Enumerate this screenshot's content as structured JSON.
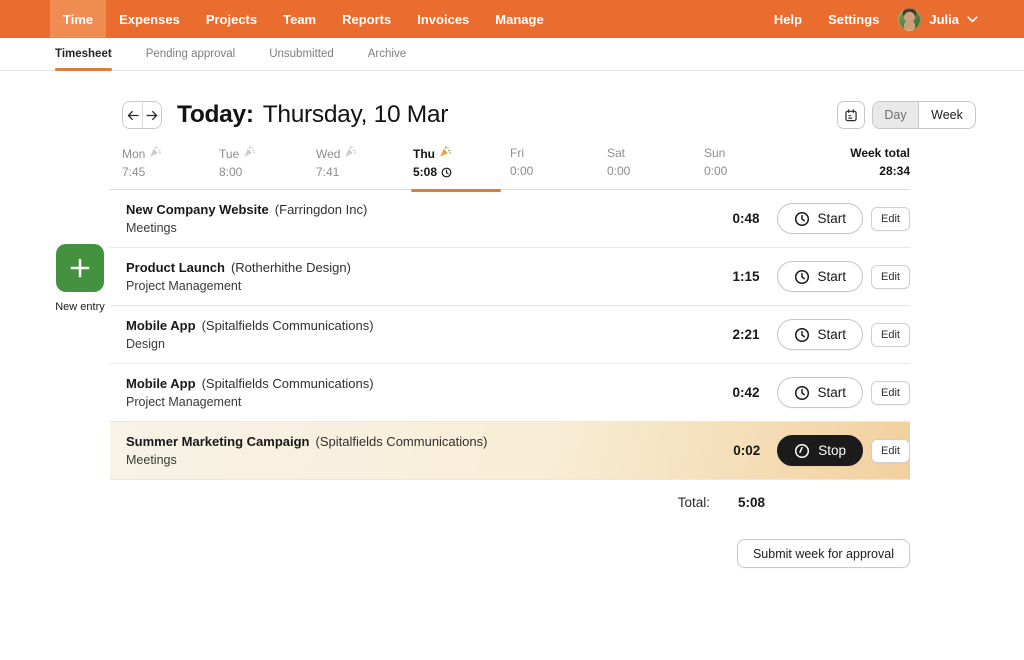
{
  "colors": {
    "brand_orange": "#ea6c2e",
    "nav_active_bg": "#f08b52",
    "accent_underline": "#e07b3b",
    "new_entry_green": "#44913f",
    "run_grad_start": "#f8f3e7",
    "run_grad_mid": "#f8edd6",
    "run_grad_end": "#f2d09e",
    "stop_bg": "#1b1b1b"
  },
  "topnav": {
    "items": [
      "Time",
      "Expenses",
      "Projects",
      "Team",
      "Reports",
      "Invoices",
      "Manage"
    ],
    "active_item": "Time",
    "help": "Help",
    "settings": "Settings",
    "user_name": "Julia"
  },
  "subnav": {
    "tabs": [
      "Timesheet",
      "Pending approval",
      "Unsubmitted",
      "Archive"
    ],
    "active_tab": "Timesheet"
  },
  "header": {
    "title_label": "Today:",
    "title_date": "Thursday, 10 Mar",
    "view_day": "Day",
    "view_week": "Week",
    "selected_view": "Day"
  },
  "new_entry": {
    "label": "New entry"
  },
  "week_strip": {
    "days": [
      {
        "name": "Mon",
        "time": "7:45",
        "celebration": true,
        "active": false
      },
      {
        "name": "Tue",
        "time": "8:00",
        "celebration": true,
        "active": false
      },
      {
        "name": "Wed",
        "time": "7:41",
        "celebration": true,
        "active": false
      },
      {
        "name": "Thu",
        "time": "5:08",
        "celebration": true,
        "active": true,
        "running": true
      },
      {
        "name": "Fri",
        "time": "0:00",
        "celebration": false,
        "active": false
      },
      {
        "name": "Sat",
        "time": "0:00",
        "celebration": false,
        "active": false
      },
      {
        "name": "Sun",
        "time": "0:00",
        "celebration": false,
        "active": false
      }
    ],
    "week_total_label": "Week total",
    "week_total_value": "28:34"
  },
  "entries": [
    {
      "project": "New Company Website",
      "client": "(Farringdon Inc)",
      "task": "Meetings",
      "time": "0:48",
      "action": "Start",
      "running": false
    },
    {
      "project": "Product Launch",
      "client": "(Rotherhithe Design)",
      "task": "Project Management",
      "time": "1:15",
      "action": "Start",
      "running": false
    },
    {
      "project": "Mobile App",
      "client": "(Spitalfields Communications)",
      "task": "Design",
      "time": "2:21",
      "action": "Start",
      "running": false
    },
    {
      "project": "Mobile App",
      "client": "(Spitalfields Communications)",
      "task": "Project Management",
      "time": "0:42",
      "action": "Start",
      "running": false
    },
    {
      "project": "Summer Marketing Campaign",
      "client": "(Spitalfields Communications)",
      "task": "Meetings",
      "time": "0:02",
      "action": "Stop",
      "running": true
    }
  ],
  "labels": {
    "edit": "Edit"
  },
  "footer": {
    "total_label": "Total:",
    "total_value": "5:08",
    "submit_label": "Submit week for approval"
  }
}
